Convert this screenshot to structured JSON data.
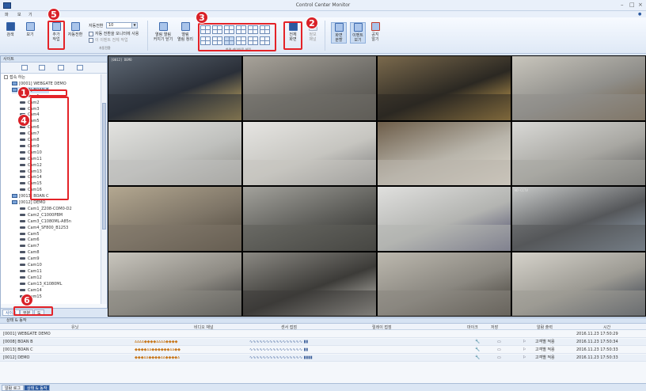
{
  "window": {
    "title": "Control Center Monitor",
    "minimize": "–",
    "maximize": "□",
    "close": "×"
  },
  "menu": {
    "tab_file": "파",
    "tab_view": "보",
    "tab_extra": "기"
  },
  "ribbon": {
    "buttons": [
      {
        "label": "검색"
      },
      {
        "label": "보기"
      },
      {
        "label": "추가\n작업"
      },
      {
        "label": "자동전환"
      },
      {
        "label": "열림 열림\n커지기 닫기"
      },
      {
        "label": "열림\n열림 정리"
      },
      {
        "label": "전체\n화면"
      },
      {
        "label": "정보\n패널"
      },
      {
        "label": "화면\n분할"
      },
      {
        "label": "이벤트\n보기"
      },
      {
        "label": "공지\n알기"
      }
    ],
    "interval_label": "자동전환",
    "interval_value": "10",
    "check_monitor": "자동 전환을 모니터에 사용",
    "check_event": "이 이벤트 전체 작업",
    "group_auto": "자동전환",
    "group_layout": "화면 레이아웃 설정"
  },
  "sidebar": {
    "header": "사이트",
    "tabs": [
      "사이트",
      "부분",
      "도"
    ],
    "tree": [
      {
        "label": "접속 하는",
        "type": "folder",
        "indent": 0
      },
      {
        "label": "[0001] WEBGATE DEMO",
        "type": "server",
        "indent": 1
      },
      {
        "label": "[0008] BOAN B",
        "type": "server",
        "indent": 1
      },
      {
        "label": "Cam1",
        "type": "cam",
        "indent": 2
      },
      {
        "label": "Cam2",
        "type": "cam",
        "indent": 2
      },
      {
        "label": "Cam3",
        "type": "cam",
        "indent": 2
      },
      {
        "label": "Cam4",
        "type": "cam",
        "indent": 2
      },
      {
        "label": "Cam5",
        "type": "cam",
        "indent": 2
      },
      {
        "label": "Cam6",
        "type": "cam",
        "indent": 2
      },
      {
        "label": "Cam7",
        "type": "cam",
        "indent": 2
      },
      {
        "label": "Cam8",
        "type": "cam",
        "indent": 2
      },
      {
        "label": "Cam9",
        "type": "cam",
        "indent": 2
      },
      {
        "label": "Cam10",
        "type": "cam",
        "indent": 2
      },
      {
        "label": "Cam11",
        "type": "cam",
        "indent": 2
      },
      {
        "label": "Cam12",
        "type": "cam",
        "indent": 2
      },
      {
        "label": "Cam13",
        "type": "cam",
        "indent": 2
      },
      {
        "label": "Cam14",
        "type": "cam",
        "indent": 2
      },
      {
        "label": "Cam15",
        "type": "cam",
        "indent": 2
      },
      {
        "label": "Cam16",
        "type": "cam",
        "indent": 2
      },
      {
        "label": "[0013] BOAN C",
        "type": "server",
        "indent": 1
      },
      {
        "label": "[0012] DEMO",
        "type": "server",
        "indent": 1
      },
      {
        "label": "Cam1_Z208-COM0-D2",
        "type": "cam",
        "indent": 2
      },
      {
        "label": "Cam2_C1000PBM",
        "type": "cam",
        "indent": 2
      },
      {
        "label": "Cam3_C1080ML-A85n",
        "type": "cam",
        "indent": 2
      },
      {
        "label": "Cam4_SF800_B1253",
        "type": "cam",
        "indent": 2
      },
      {
        "label": "Cam5",
        "type": "cam",
        "indent": 2
      },
      {
        "label": "Cam6",
        "type": "cam",
        "indent": 2
      },
      {
        "label": "Cam7",
        "type": "cam",
        "indent": 2
      },
      {
        "label": "Cam8",
        "type": "cam",
        "indent": 2
      },
      {
        "label": "Cam9",
        "type": "cam",
        "indent": 2
      },
      {
        "label": "Cam10",
        "type": "cam",
        "indent": 2
      },
      {
        "label": "Cam11",
        "type": "cam",
        "indent": 2
      },
      {
        "label": "Cam12",
        "type": "cam",
        "indent": 2
      },
      {
        "label": "Cam13_K1080ML",
        "type": "cam",
        "indent": 2
      },
      {
        "label": "Cam14",
        "type": "cam",
        "indent": 2
      },
      {
        "label": "Cam15",
        "type": "cam",
        "indent": 2
      }
    ]
  },
  "video_tiles": [
    {
      "osd": "[0012] DEMO",
      "scene": "night"
    },
    {
      "osd": "",
      "scene": "office"
    },
    {
      "osd": "",
      "scene": "night2"
    },
    {
      "osd": "",
      "scene": "warehouse"
    },
    {
      "osd": "",
      "scene": "hall"
    },
    {
      "osd": "",
      "scene": "corridor"
    },
    {
      "osd": "",
      "scene": "boxes"
    },
    {
      "osd": "",
      "scene": "room"
    },
    {
      "osd": "",
      "scene": "stock"
    },
    {
      "osd": "",
      "scene": "fisheye"
    },
    {
      "osd": "",
      "scene": "lab"
    },
    {
      "osd": "HD-CCTV",
      "scene": "control"
    },
    {
      "osd": "",
      "scene": "factory"
    },
    {
      "osd": "",
      "scene": "fisheye2"
    },
    {
      "osd": "",
      "scene": "racks"
    },
    {
      "osd": "",
      "scene": "shop"
    }
  ],
  "badges": [
    "1",
    "2",
    "3",
    "4",
    "5",
    "6"
  ],
  "event_panel": {
    "title": "상태 & 동작",
    "columns": [
      "유닛",
      "비디오 채널",
      "센서 접점",
      "릴레이 접점",
      "마이크",
      "저장",
      "알람 출력",
      "시간"
    ],
    "rows": [
      {
        "unit": "[0001] WEBGATE DEMO",
        "video": "",
        "sensor": "",
        "relay": "",
        "time": "2016.11.23 17:50:29"
      },
      {
        "unit": "[0008] BOAN B",
        "video": "ᴀᴀᴀᴀ◆◆◆◆ᴀᴀᴀᴀ◆◆◆◆",
        "sensor": "∿∿∿∿∿∿∿∿∿∿∿∿∿∿∿∿ ▮▮",
        "relay": "",
        "alarm": "고객별 적용",
        "time": "2016.11.23 17:50:34"
      },
      {
        "unit": "[0013] BOAN C",
        "video": "◆◆◆◆ᴀᴀ◆◆◆◆◆◆ᴀᴀ◆◆",
        "sensor": "∿∿∿∿∿∿∿∿∿∿∿∿∿∿∿∿ ▮▮",
        "relay": "",
        "alarm": "고객별 적용",
        "time": "2016.11.23 17:50:33"
      },
      {
        "unit": "[0012] DEMO",
        "video": "◆◆◆ᴀᴀ◆◆◆◆ᴀᴀ◆◆◆◆ᴀ",
        "sensor": "∿∿∿∿∿∿∿∿∿∿∿∿∿∿∿∿ ▮▮▮▮",
        "relay": "",
        "alarm": "고객별 적용",
        "time": "2016.11.23 17:50:33"
      }
    ],
    "tabs": [
      "알람 로그",
      "상태 & 동작"
    ]
  }
}
